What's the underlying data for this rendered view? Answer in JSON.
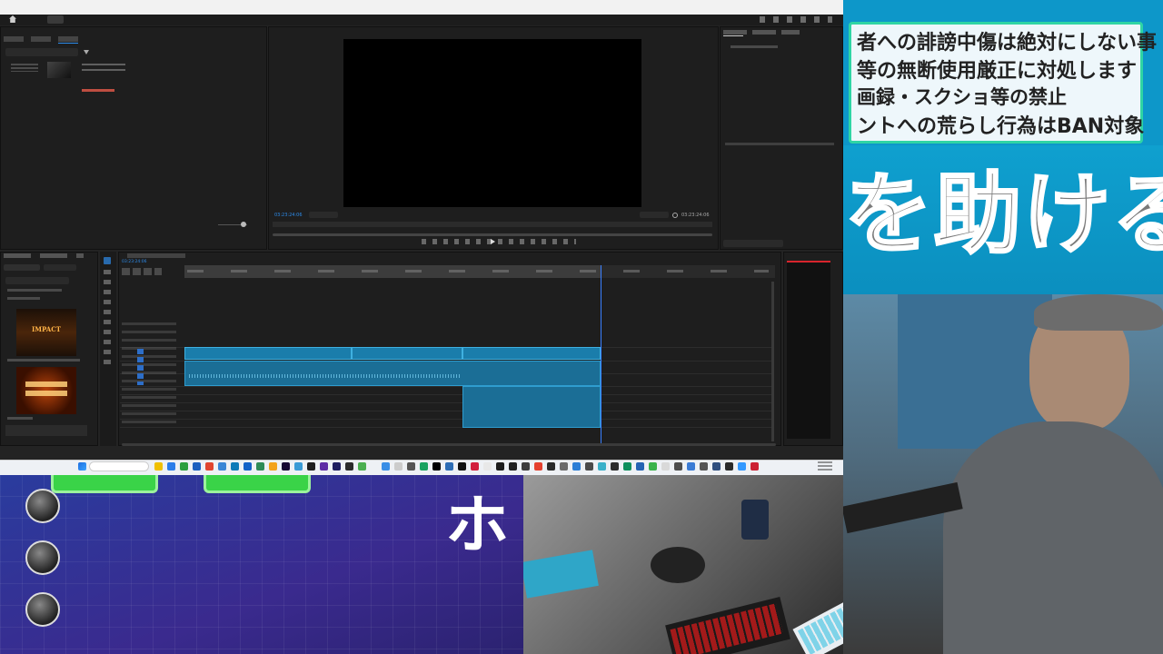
{
  "overlay": {
    "rules": [
      "者への誹謗中傷は絶対にしない事",
      "等の無断使用厳正に対処します",
      "画録・スクショ等の禁止",
      "ントへの荒らし行為はBAN対象"
    ],
    "slogan": "を助ける",
    "arrow_glyph": "ホ"
  },
  "colors": {
    "rules_bg": "#0d97c9",
    "rules_border": "#2fd5a4",
    "game_bar": "#3ad348",
    "clip_blue": "#1a7dab",
    "timecode_blue": "#2d8ceb",
    "playhead": "#3a7fff",
    "meter_red": "#d8242c"
  },
  "editor": {
    "monitor": {
      "timecode_left": "03:23:24:06",
      "timecode_right": "03:23:24:06"
    },
    "effects": {
      "thumb1_title": "IMPACT"
    },
    "timeline": {
      "sequence_tab": "2026-03-22_21-57-04",
      "timecode": "03:23:24:06"
    }
  },
  "icons": [
    "home-icon",
    "search-icon",
    "filter-icon",
    "wrench-icon",
    "play-icon",
    "step-back-icon",
    "step-forward-icon",
    "windows-start-icon"
  ]
}
